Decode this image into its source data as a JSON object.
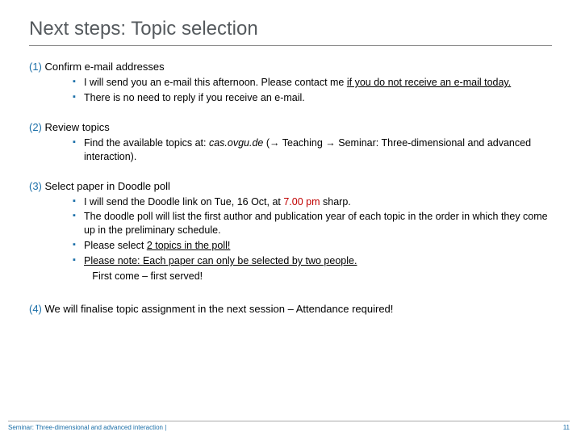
{
  "title": "Next steps: Topic selection",
  "sections": [
    {
      "num": "(1)",
      "head": "Confirm e-mail addresses",
      "items": [
        {
          "pre": "I will send you an e-mail this afternoon. Please contact me ",
          "u": "if you do not receive an e-mail today."
        },
        {
          "text": "There is no need to reply if you receive an e-mail."
        }
      ]
    },
    {
      "num": "(2)",
      "head": "Review topics",
      "items": [
        {
          "pre": "Find the available topics at: ",
          "it": "cas.ovgu.de",
          "post": " (→ Teaching → Seminar: Three-dimensional and advanced interaction)."
        }
      ]
    },
    {
      "num": "(3)",
      "head": "Select paper in Doodle poll",
      "items": [
        {
          "pre": "I will send the  Doodle link on Tue, 16 Oct, at ",
          "red": "7.00 pm",
          "post": " sharp."
        },
        {
          "text": "The doodle poll will list the first author and publication year of each topic in  the order in which they come up in the preliminary schedule."
        },
        {
          "pre": "Please select ",
          "u": "2 topics in the poll!"
        },
        {
          "u": "Please note: Each paper can only be selected by two people."
        },
        {
          "plain": "       First come – first served!"
        }
      ]
    },
    {
      "num": "(4)",
      "head": "We will finalise topic assignment in the next session – Attendance required!",
      "items": []
    }
  ],
  "footer": {
    "left": "Seminar: Three-dimensional and advanced interaction |",
    "right": "11"
  }
}
